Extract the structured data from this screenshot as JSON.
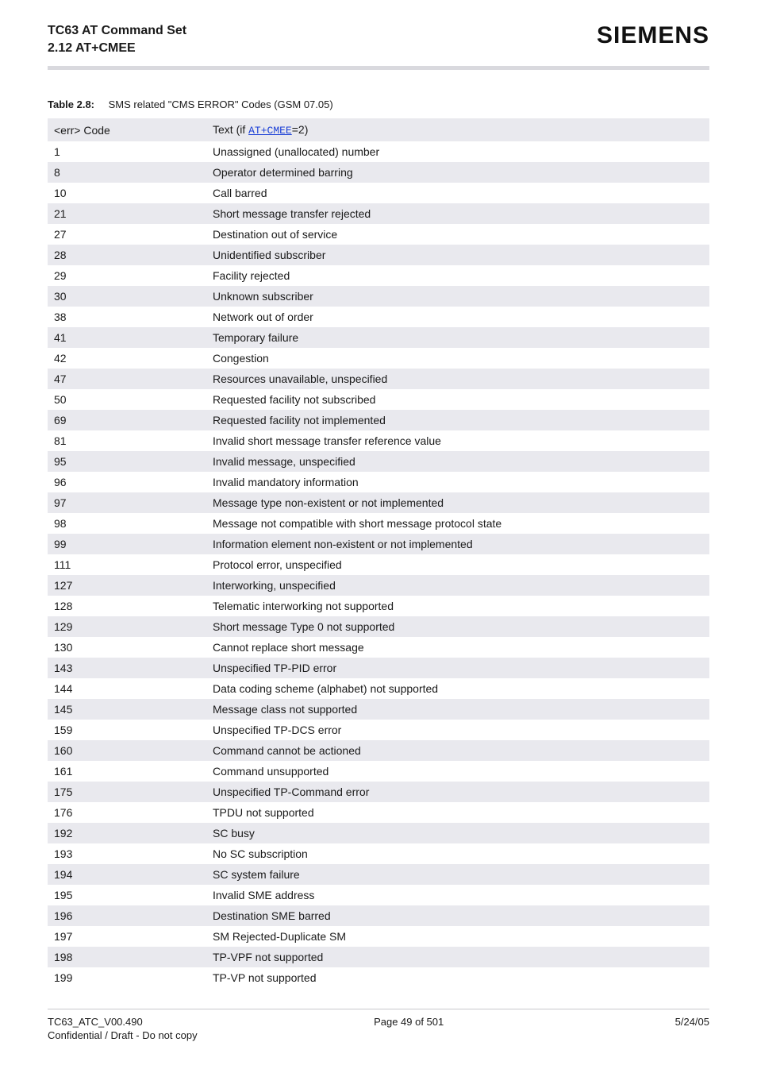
{
  "header": {
    "title_line1": "TC63 AT Command Set",
    "title_line2": "2.12 AT+CMEE",
    "brand": "SIEMENS"
  },
  "table": {
    "label": "Table 2.8:",
    "caption": "SMS related \"CMS ERROR\" Codes (GSM 07.05)",
    "head_code": "<err> Code",
    "head_text_prefix": "Text (if ",
    "head_text_link": "AT+CMEE",
    "head_text_suffix": "=2)",
    "rows": [
      {
        "code": "1",
        "text": "Unassigned (unallocated) number"
      },
      {
        "code": "8",
        "text": "Operator determined barring"
      },
      {
        "code": "10",
        "text": "Call barred"
      },
      {
        "code": "21",
        "text": "Short message transfer rejected"
      },
      {
        "code": "27",
        "text": "Destination out of service"
      },
      {
        "code": "28",
        "text": "Unidentified subscriber"
      },
      {
        "code": "29",
        "text": "Facility rejected"
      },
      {
        "code": "30",
        "text": "Unknown subscriber"
      },
      {
        "code": "38",
        "text": "Network out of order"
      },
      {
        "code": "41",
        "text": "Temporary failure"
      },
      {
        "code": "42",
        "text": "Congestion"
      },
      {
        "code": "47",
        "text": "Resources unavailable, unspecified"
      },
      {
        "code": "50",
        "text": "Requested facility not subscribed"
      },
      {
        "code": "69",
        "text": "Requested facility not implemented"
      },
      {
        "code": "81",
        "text": "Invalid short message transfer reference value"
      },
      {
        "code": "95",
        "text": "Invalid message, unspecified"
      },
      {
        "code": "96",
        "text": "Invalid mandatory information"
      },
      {
        "code": "97",
        "text": "Message type non-existent or not implemented"
      },
      {
        "code": "98",
        "text": "Message not compatible with short message protocol state"
      },
      {
        "code": "99",
        "text": "Information element non-existent or not implemented"
      },
      {
        "code": "111",
        "text": "Protocol error, unspecified"
      },
      {
        "code": "127",
        "text": "Interworking, unspecified"
      },
      {
        "code": "128",
        "text": "Telematic interworking not supported"
      },
      {
        "code": "129",
        "text": "Short message Type 0 not supported"
      },
      {
        "code": "130",
        "text": "Cannot replace short message"
      },
      {
        "code": "143",
        "text": "Unspecified TP-PID error"
      },
      {
        "code": "144",
        "text": "Data coding scheme (alphabet) not supported"
      },
      {
        "code": "145",
        "text": "Message class not supported"
      },
      {
        "code": "159",
        "text": "Unspecified TP-DCS error"
      },
      {
        "code": "160",
        "text": "Command cannot be actioned"
      },
      {
        "code": "161",
        "text": "Command unsupported"
      },
      {
        "code": "175",
        "text": "Unspecified TP-Command error"
      },
      {
        "code": "176",
        "text": "TPDU not supported"
      },
      {
        "code": "192",
        "text": "SC busy"
      },
      {
        "code": "193",
        "text": "No SC subscription"
      },
      {
        "code": "194",
        "text": "SC system failure"
      },
      {
        "code": "195",
        "text": "Invalid SME address"
      },
      {
        "code": "196",
        "text": "Destination SME barred"
      },
      {
        "code": "197",
        "text": "SM Rejected-Duplicate SM"
      },
      {
        "code": "198",
        "text": "TP-VPF not supported"
      },
      {
        "code": "199",
        "text": "TP-VP not supported"
      }
    ]
  },
  "footer": {
    "left": "TC63_ATC_V00.490",
    "center": "Page 49 of 501",
    "right": "5/24/05",
    "sub": "Confidential / Draft - Do not copy"
  }
}
